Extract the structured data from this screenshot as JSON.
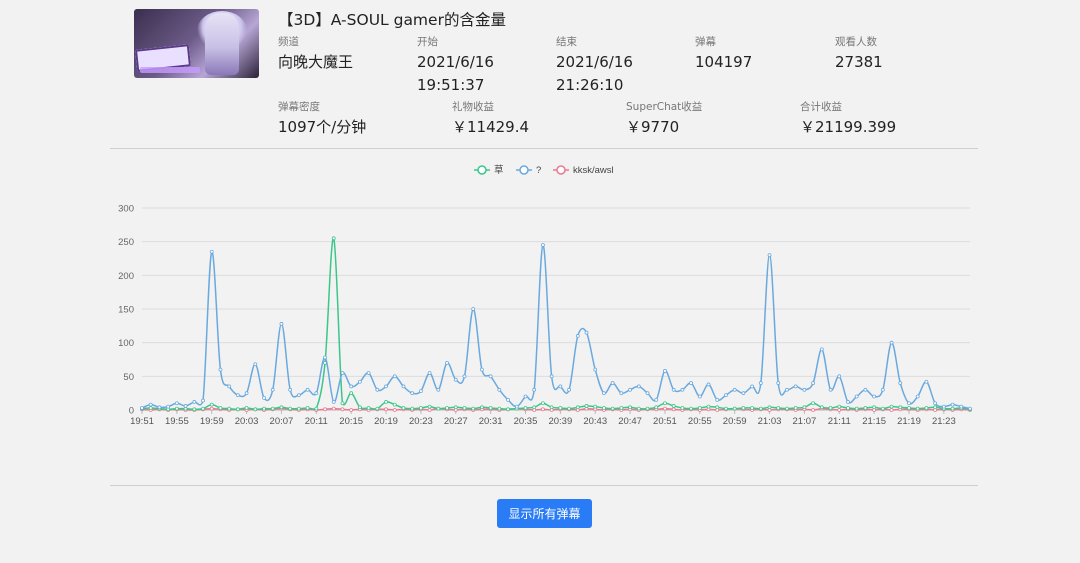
{
  "stream": {
    "title": "【3D】A-SOUL gamer的含金量",
    "stats_row1": [
      {
        "label": "频道",
        "value": "向晚大魔王"
      },
      {
        "label": "开始",
        "value": "2021/6/16",
        "value2": "19:51:37"
      },
      {
        "label": "结束",
        "value": "2021/6/16",
        "value2": "21:26:10"
      },
      {
        "label": "弹幕",
        "value": "104197"
      },
      {
        "label": "观看人数",
        "value": "27381"
      }
    ],
    "stats_row2": [
      {
        "label": "弹幕密度",
        "value": "1097个/分钟"
      },
      {
        "label": "礼物收益",
        "value": "￥11429.4"
      },
      {
        "label": "SuperChat收益",
        "value": "￥9770"
      },
      {
        "label": "合计收益",
        "value": "￥21199.399"
      }
    ]
  },
  "button": {
    "label": "显示所有弹幕"
  },
  "colors": {
    "series1": "#3cc68a",
    "series2": "#6aa9de",
    "series3": "#e87a8f",
    "accent": "#2a7bf6"
  },
  "chart_data": {
    "type": "line",
    "legend_position": "top-center",
    "grid": true,
    "ylim": [
      0,
      300
    ],
    "yticks": [
      "0",
      "50",
      "100",
      "150",
      "200",
      "250",
      "300"
    ],
    "xticks": [
      "19:51",
      "19:55",
      "19:59",
      "20:03",
      "20:07",
      "20:11",
      "20:15",
      "20:19",
      "20:23",
      "20:27",
      "20:31",
      "20:35",
      "20:39",
      "20:43",
      "20:47",
      "20:51",
      "20:55",
      "20:59",
      "21:03",
      "21:07",
      "21:11",
      "21:15",
      "21:19",
      "21:23"
    ],
    "x": [
      "19:51",
      "19:52",
      "19:53",
      "19:54",
      "19:55",
      "19:56",
      "19:57",
      "19:58",
      "19:59",
      "20:00",
      "20:01",
      "20:02",
      "20:03",
      "20:04",
      "20:05",
      "20:06",
      "20:07",
      "20:08",
      "20:09",
      "20:10",
      "20:11",
      "20:12",
      "20:13",
      "20:14",
      "20:15",
      "20:16",
      "20:17",
      "20:18",
      "20:19",
      "20:20",
      "20:21",
      "20:22",
      "20:23",
      "20:24",
      "20:25",
      "20:26",
      "20:27",
      "20:28",
      "20:29",
      "20:30",
      "20:31",
      "20:32",
      "20:33",
      "20:34",
      "20:35",
      "20:36",
      "20:37",
      "20:38",
      "20:39",
      "20:40",
      "20:41",
      "20:42",
      "20:43",
      "20:44",
      "20:45",
      "20:46",
      "20:47",
      "20:48",
      "20:49",
      "20:50",
      "20:51",
      "20:52",
      "20:53",
      "20:54",
      "20:55",
      "20:56",
      "20:57",
      "20:58",
      "20:59",
      "21:00",
      "21:01",
      "21:02",
      "21:03",
      "21:04",
      "21:05",
      "21:06",
      "21:07",
      "21:08",
      "21:09",
      "21:10",
      "21:11",
      "21:12",
      "21:13",
      "21:14",
      "21:15",
      "21:16",
      "21:17",
      "21:18",
      "21:19",
      "21:20",
      "21:21",
      "21:22",
      "21:23",
      "21:24",
      "21:25",
      "21:26"
    ],
    "series": [
      {
        "name": "草",
        "values": [
          2,
          3,
          2,
          1,
          2,
          2,
          1,
          2,
          8,
          3,
          2,
          1,
          3,
          1,
          2,
          2,
          4,
          2,
          2,
          3,
          2,
          70,
          255,
          10,
          25,
          4,
          3,
          2,
          12,
          8,
          3,
          2,
          3,
          5,
          2,
          3,
          4,
          3,
          2,
          4,
          3,
          2,
          1,
          2,
          3,
          4,
          10,
          4,
          3,
          2,
          4,
          6,
          5,
          3,
          2,
          3,
          4,
          2,
          2,
          4,
          10,
          6,
          3,
          2,
          3,
          5,
          4,
          2,
          2,
          3,
          3,
          2,
          4,
          3,
          2,
          3,
          4,
          10,
          4,
          3,
          5,
          3,
          2,
          3,
          4,
          2,
          5,
          4,
          3,
          2,
          3,
          4,
          2,
          2,
          3,
          1
        ]
      },
      {
        "name": "?",
        "values": [
          3,
          8,
          4,
          5,
          10,
          6,
          12,
          14,
          235,
          60,
          35,
          22,
          25,
          68,
          18,
          30,
          128,
          30,
          22,
          30,
          25,
          78,
          12,
          55,
          35,
          42,
          55,
          30,
          35,
          50,
          35,
          25,
          28,
          55,
          30,
          70,
          45,
          50,
          150,
          60,
          50,
          30,
          15,
          5,
          20,
          30,
          245,
          50,
          35,
          30,
          110,
          115,
          60,
          25,
          40,
          25,
          30,
          35,
          25,
          15,
          58,
          30,
          30,
          40,
          20,
          38,
          15,
          22,
          30,
          25,
          35,
          40,
          230,
          40,
          30,
          35,
          30,
          40,
          90,
          30,
          50,
          12,
          20,
          30,
          20,
          30,
          100,
          40,
          10,
          20,
          42,
          10,
          5,
          8,
          5,
          2
        ]
      },
      {
        "name": "kksk/awsl",
        "values": [
          1,
          0,
          1,
          0,
          1,
          0,
          0,
          1,
          2,
          1,
          0,
          1,
          0,
          1,
          0,
          1,
          2,
          1,
          0,
          1,
          0,
          1,
          2,
          1,
          0,
          1,
          0,
          1,
          1,
          0,
          1,
          0,
          1,
          0,
          2,
          1,
          0,
          1,
          0,
          1,
          1,
          0,
          1,
          2,
          1,
          0,
          1,
          0,
          1,
          1,
          0,
          2,
          1,
          0,
          1,
          0,
          1,
          0,
          1,
          1,
          2,
          1,
          0,
          1,
          0,
          1,
          0,
          1,
          2,
          1,
          0,
          1,
          0,
          1,
          1,
          0,
          1,
          0,
          2,
          1,
          0,
          1,
          0,
          1,
          0,
          1,
          0,
          1,
          1,
          0,
          1,
          0,
          1,
          0,
          1,
          0
        ]
      }
    ]
  }
}
